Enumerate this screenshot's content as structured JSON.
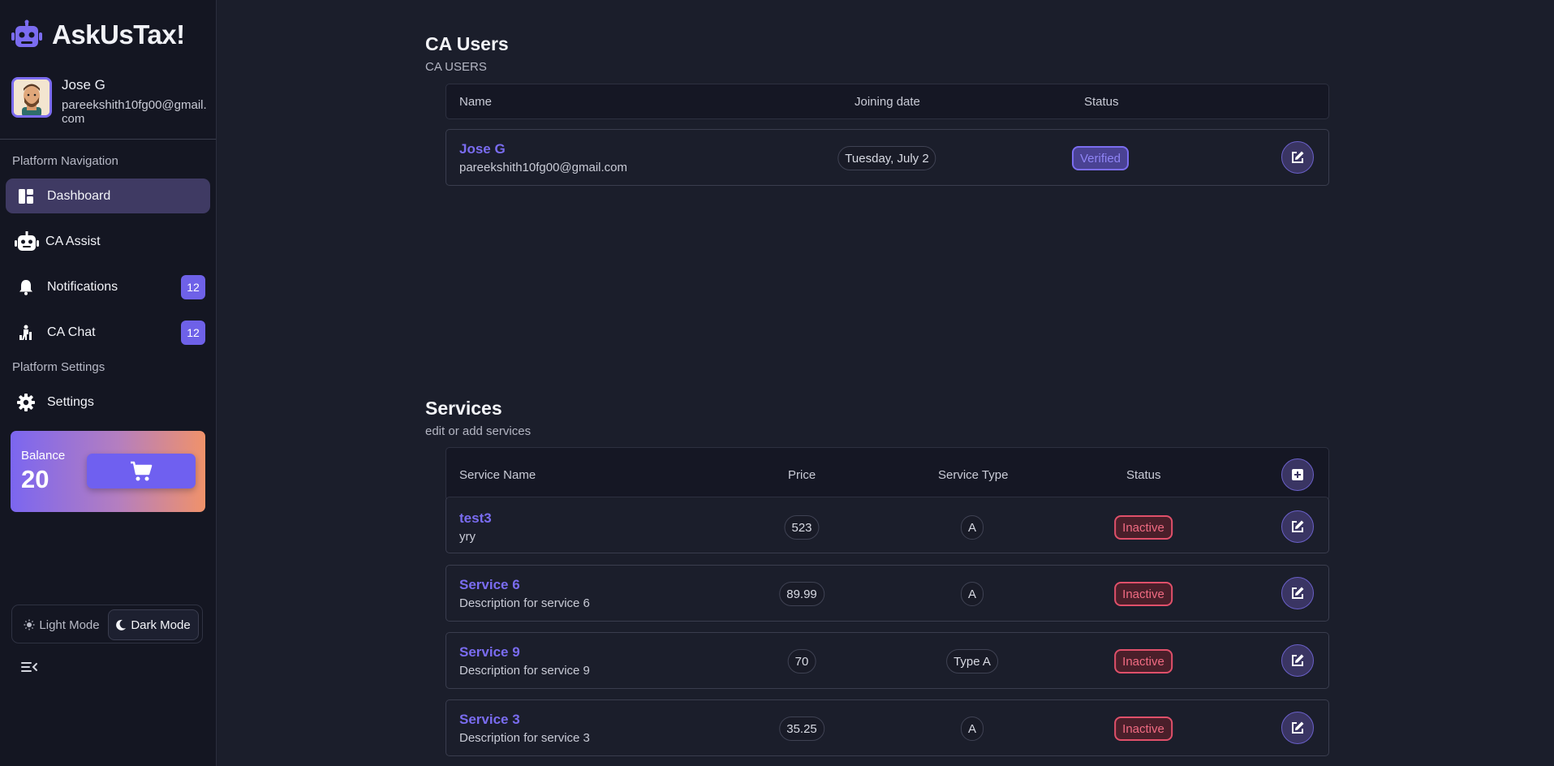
{
  "app": {
    "name": "AskUsTax!"
  },
  "profile": {
    "name": "Jose G",
    "email": "pareekshith10fg00@gmail.com"
  },
  "sidebar": {
    "platform_navigation_label": "Platform Navigation",
    "platform_settings_label": "Platform Settings",
    "items": [
      {
        "label": "Dashboard",
        "icon": "dashboard-icon",
        "active": true
      },
      {
        "label": "CA Assist",
        "icon": "robot-icon"
      },
      {
        "label": "Notifications",
        "icon": "bell-icon",
        "badge": "12"
      },
      {
        "label": "CA Chat",
        "icon": "chat-figure-icon",
        "badge": "12"
      },
      {
        "label": "Settings",
        "icon": "gear-icon"
      }
    ],
    "balance": {
      "label": "Balance",
      "value": "20"
    },
    "theme": {
      "light_label": "Light Mode",
      "dark_label": "Dark Mode",
      "selected": "Dark Mode"
    }
  },
  "ca_users": {
    "title": "CA Users",
    "subtitle": "CA USERS",
    "headers": {
      "name": "Name",
      "joining_date": "Joining date",
      "status": "Status"
    },
    "rows": [
      {
        "name": "Jose G",
        "email": "pareekshith10fg00@gmail.com",
        "joining_date": "Tuesday, July 2",
        "status": "Verified"
      }
    ]
  },
  "services": {
    "title": "Services",
    "subtitle": "edit or add services",
    "headers": {
      "name": "Service Name",
      "price": "Price",
      "type": "Service Type",
      "status": "Status"
    },
    "rows": [
      {
        "name": "test3",
        "description": "yry",
        "price": "523",
        "type": "A",
        "status": "Inactive"
      },
      {
        "name": "Service 6",
        "description": "Description for service 6",
        "price": "89.99",
        "type": "A",
        "status": "Inactive"
      },
      {
        "name": "Service 9",
        "description": "Description for service 9",
        "price": "70",
        "type": "Type A",
        "status": "Inactive"
      },
      {
        "name": "Service 3",
        "description": "Description for service 3",
        "price": "35.25",
        "type": "A",
        "status": "Inactive"
      }
    ]
  },
  "colors": {
    "accent": "#6e61e8",
    "inactive": "#e0506a",
    "background": "#1b1e2b",
    "sidebar": "#141622"
  }
}
